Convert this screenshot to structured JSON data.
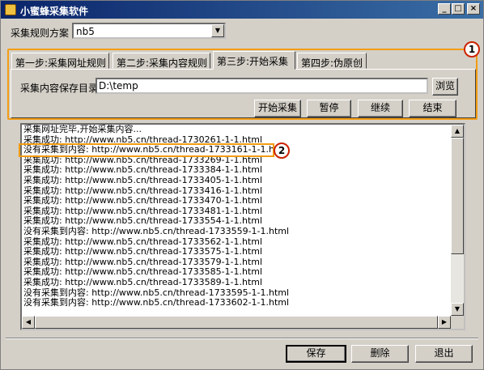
{
  "window": {
    "title": "小蜜蜂采集软件",
    "controls": {
      "minimize": "_",
      "maximize": "□",
      "close": "×"
    }
  },
  "scheme": {
    "label": "采集规则方案",
    "value": "nb5"
  },
  "tabs": [
    {
      "label": "第一步:采集网址规则"
    },
    {
      "label": "第二步:采集内容规则"
    },
    {
      "label": "第三步:开始采集"
    },
    {
      "label": "第四步:伪原创"
    }
  ],
  "active_tab": "第三步:开始采集",
  "save_dir": {
    "label": "采集内容保存目录",
    "value": "D:\\temp",
    "browse": "浏览"
  },
  "actions": {
    "start": "开始采集",
    "pause": "暂停",
    "resume": "继续",
    "stop": "结束"
  },
  "log": [
    "采集网址完毕,开始采集内容...",
    "采集成功: http://www.nb5.cn/thread-1730261-1-1.html",
    "没有采集到内容: http://www.nb5.cn/thread-1733161-1-1.html",
    "采集成功: http://www.nb5.cn/thread-1733269-1-1.html",
    "采集成功: http://www.nb5.cn/thread-1733384-1-1.html",
    "采集成功: http://www.nb5.cn/thread-1733405-1-1.html",
    "采集成功: http://www.nb5.cn/thread-1733416-1-1.html",
    "采集成功: http://www.nb5.cn/thread-1733470-1-1.html",
    "采集成功: http://www.nb5.cn/thread-1733481-1-1.html",
    "采集成功: http://www.nb5.cn/thread-1733554-1-1.html",
    "没有采集到内容: http://www.nb5.cn/thread-1733559-1-1.html",
    "采集成功: http://www.nb5.cn/thread-1733562-1-1.html",
    "采集成功: http://www.nb5.cn/thread-1733575-1-1.html",
    "采集成功: http://www.nb5.cn/thread-1733579-1-1.html",
    "采集成功: http://www.nb5.cn/thread-1733585-1-1.html",
    "采集成功: http://www.nb5.cn/thread-1733589-1-1.html",
    "没有采集到内容: http://www.nb5.cn/thread-1733595-1-1.html",
    "没有采集到内容: http://www.nb5.cn/thread-1733602-1-1.html"
  ],
  "footer": {
    "save": "保存",
    "delete": "删除",
    "exit": "退出"
  },
  "annotations": {
    "callout_1": "1",
    "callout_2": "2"
  },
  "colors": {
    "highlight": "#f39c12",
    "callout_border": "#cc2200",
    "titlebar": "#0a246a"
  }
}
